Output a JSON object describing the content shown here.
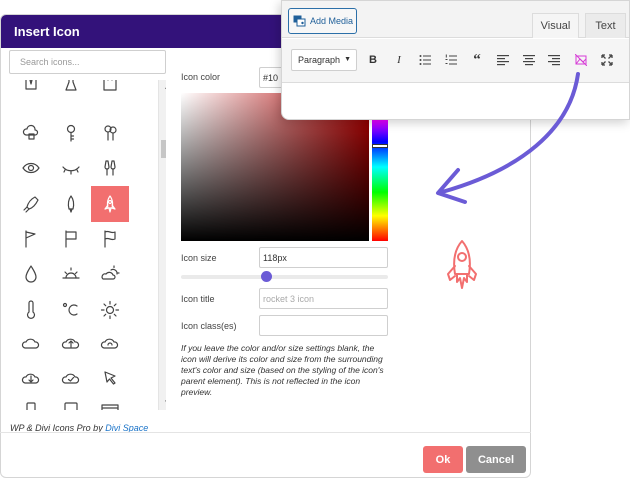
{
  "dialog": {
    "title": "Insert Icon",
    "search_placeholder": "Search icons...",
    "icon_color_label": "Icon color",
    "icon_color_value": "#10",
    "icon_size_label": "Icon size",
    "icon_size_value": "118px",
    "icon_size_slider_fraction": 0.41,
    "icon_title_label": "Icon title",
    "icon_title_placeholder": "rocket 3 icon",
    "icon_classes_label": "Icon class(es)",
    "icon_classes_value": "",
    "note": "If you leave the color and/or size settings blank, the icon will derive its color and size from the surrounding text's color and size (based on the styling of the icon's parent element). This is not reflected in the icon preview.",
    "credit_prefix": "WP & Divi Icons Pro by ",
    "credit_link": "Divi Space",
    "ok_label": "Ok",
    "cancel_label": "Cancel",
    "selected_icon": "rocket-3-icon",
    "accent_color": "#f26f6f",
    "header_color": "#33127a",
    "icons": [
      "bucket-icon",
      "flask-icon",
      "box-icon",
      "cloud-lock-icon",
      "key-icon",
      "keys-icon",
      "eye-icon",
      "eye-closed-icon",
      "champagne-icon",
      "rocket-icon",
      "rocket-2-icon",
      "rocket-3-icon",
      "flag-icon",
      "flag-2-icon",
      "flag-3-icon",
      "drop-icon",
      "sunrise-icon",
      "cloud-sun-icon",
      "thermometer-icon",
      "celsius-icon",
      "sun-icon",
      "cloud-icon",
      "cloud-upload-icon",
      "cloud-sync-icon",
      "cloud-download-icon",
      "cloud-check-icon",
      "cursor-icon",
      "mobile-icon",
      "tablet-icon",
      "window-icon"
    ]
  },
  "editor": {
    "add_media_label": "Add Media",
    "tab_visual": "Visual",
    "tab_text": "Text",
    "format_select": "Paragraph",
    "toolbar_icons": [
      "bold-icon",
      "italic-icon",
      "bulleted-list-icon",
      "numbered-list-icon",
      "blockquote-icon",
      "align-left-icon",
      "align-center-icon",
      "align-right-icon",
      "insert-icon-button-icon",
      "fullscreen-icon"
    ],
    "insert_icon_color": "#d63cd6"
  },
  "arrow_color": "#6b5bd6"
}
